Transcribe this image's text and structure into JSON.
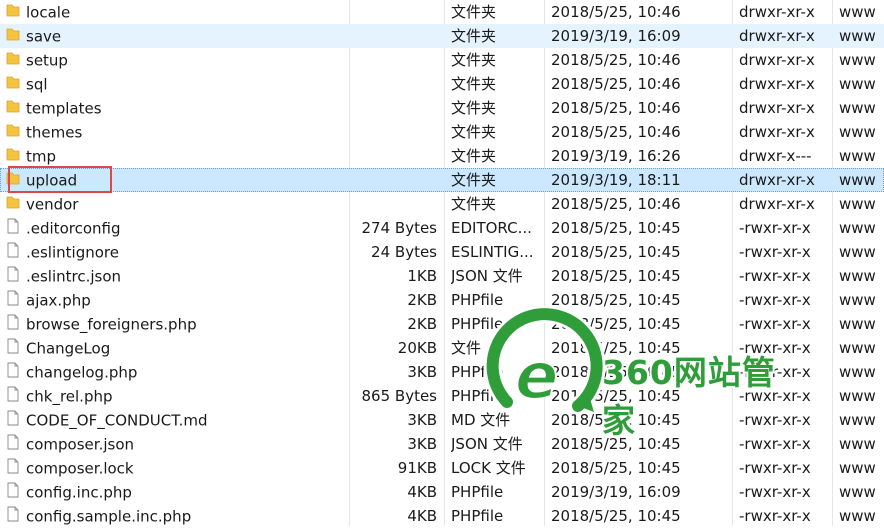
{
  "files": [
    {
      "name": "locale",
      "kind": "folder",
      "size": "",
      "type": "文件夹",
      "modified": "2018/5/25, 10:46",
      "permissions": "drwxr-xr-x",
      "owner": "www"
    },
    {
      "name": "save",
      "kind": "folder",
      "size": "",
      "type": "文件夹",
      "modified": "2019/3/19, 16:09",
      "permissions": "drwxr-xr-x",
      "owner": "www"
    },
    {
      "name": "setup",
      "kind": "folder",
      "size": "",
      "type": "文件夹",
      "modified": "2018/5/25, 10:46",
      "permissions": "drwxr-xr-x",
      "owner": "www"
    },
    {
      "name": "sql",
      "kind": "folder",
      "size": "",
      "type": "文件夹",
      "modified": "2018/5/25, 10:46",
      "permissions": "drwxr-xr-x",
      "owner": "www"
    },
    {
      "name": "templates",
      "kind": "folder",
      "size": "",
      "type": "文件夹",
      "modified": "2018/5/25, 10:46",
      "permissions": "drwxr-xr-x",
      "owner": "www"
    },
    {
      "name": "themes",
      "kind": "folder",
      "size": "",
      "type": "文件夹",
      "modified": "2018/5/25, 10:46",
      "permissions": "drwxr-xr-x",
      "owner": "www"
    },
    {
      "name": "tmp",
      "kind": "folder",
      "size": "",
      "type": "文件夹",
      "modified": "2019/3/19, 16:26",
      "permissions": "drwxr-x---",
      "owner": "www"
    },
    {
      "name": "upload",
      "kind": "folder",
      "size": "",
      "type": "文件夹",
      "modified": "2019/3/19, 18:11",
      "permissions": "drwxr-xr-x",
      "owner": "www"
    },
    {
      "name": "vendor",
      "kind": "folder",
      "size": "",
      "type": "文件夹",
      "modified": "2018/5/25, 10:46",
      "permissions": "drwxr-xr-x",
      "owner": "www"
    },
    {
      "name": ".editorconfig",
      "kind": "file",
      "size": "274 Bytes",
      "type": "EDITORC...",
      "modified": "2018/5/25, 10:45",
      "permissions": "-rwxr-xr-x",
      "owner": "www"
    },
    {
      "name": ".eslintignore",
      "kind": "file",
      "size": "24 Bytes",
      "type": "ESLINTIG...",
      "modified": "2018/5/25, 10:45",
      "permissions": "-rwxr-xr-x",
      "owner": "www"
    },
    {
      "name": ".eslintrc.json",
      "kind": "file",
      "size": "1KB",
      "type": "JSON 文件",
      "modified": "2018/5/25, 10:45",
      "permissions": "-rwxr-xr-x",
      "owner": "www"
    },
    {
      "name": "ajax.php",
      "kind": "file",
      "size": "2KB",
      "type": "PHPfile",
      "modified": "2018/5/25, 10:45",
      "permissions": "-rwxr-xr-x",
      "owner": "www"
    },
    {
      "name": "browse_foreigners.php",
      "kind": "file",
      "size": "2KB",
      "type": "PHPfile",
      "modified": "2018/5/25, 10:45",
      "permissions": "-rwxr-xr-x",
      "owner": "www"
    },
    {
      "name": "ChangeLog",
      "kind": "file",
      "size": "20KB",
      "type": "文件",
      "modified": "2018/5/25, 10:45",
      "permissions": "-rwxr-xr-x",
      "owner": "www"
    },
    {
      "name": "changelog.php",
      "kind": "file",
      "size": "3KB",
      "type": "PHPfile",
      "modified": "2018/5/25, 10:45",
      "permissions": "-rwxr-xr-x",
      "owner": "www"
    },
    {
      "name": "chk_rel.php",
      "kind": "file",
      "size": "865 Bytes",
      "type": "PHPfile",
      "modified": "2018/5/25, 10:45",
      "permissions": "-rwxr-xr-x",
      "owner": "www"
    },
    {
      "name": "CODE_OF_CONDUCT.md",
      "kind": "file",
      "size": "3KB",
      "type": "MD 文件",
      "modified": "2018/5/25, 10:45",
      "permissions": "-rwxr-xr-x",
      "owner": "www"
    },
    {
      "name": "composer.json",
      "kind": "file",
      "size": "3KB",
      "type": "JSON 文件",
      "modified": "2018/5/25, 10:45",
      "permissions": "-rwxr-xr-x",
      "owner": "www"
    },
    {
      "name": "composer.lock",
      "kind": "file",
      "size": "91KB",
      "type": "LOCK 文件",
      "modified": "2018/5/25, 10:45",
      "permissions": "-rwxr-xr-x",
      "owner": "www"
    },
    {
      "name": "config.inc.php",
      "kind": "file",
      "size": "4KB",
      "type": "PHPfile",
      "modified": "2019/3/19, 16:09",
      "permissions": "-rwxr-xr-x",
      "owner": "www"
    },
    {
      "name": "config.sample.inc.php",
      "kind": "file",
      "size": "4KB",
      "type": "PHPfile",
      "modified": "2018/5/25, 10:45",
      "permissions": "-rwxr-xr-x",
      "owner": "www"
    }
  ],
  "watermark": {
    "text": "360网站管家",
    "icon": "360-logo-icon"
  },
  "colors": {
    "folder": "#f5c342",
    "hover_row": "#e5f3ff",
    "selected_row": "#cce8ff",
    "highlight": "#e04848",
    "watermark": "#2f9e3a"
  }
}
